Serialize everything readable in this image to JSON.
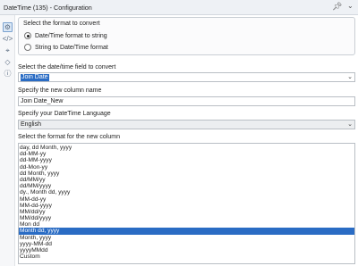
{
  "window": {
    "title": "DateTime (135) - Configuration",
    "pin_icon": "pin-icon",
    "menu_icon": "chevron-down-icon"
  },
  "toolrail": [
    "gear-icon",
    "code-icon",
    "target-icon",
    "tag-icon",
    "help-icon"
  ],
  "format_group": {
    "title": "Select the format to convert",
    "options": [
      {
        "label": "Date/Time format to string",
        "checked": true
      },
      {
        "label": "String to Date/Time format",
        "checked": false
      }
    ]
  },
  "field": {
    "label": "Select the date/time field to convert",
    "value": "Join Date"
  },
  "new_column": {
    "label": "Specify the new column name",
    "value": "Join Date_New"
  },
  "language": {
    "label": "Specify your DateTime Language",
    "value": "English"
  },
  "formats": {
    "label": "Select the format for the new column",
    "items": [
      "day, dd Month, yyyy",
      "dd-MM-yy",
      "dd-MM-yyyy",
      "dd-Mon-yy",
      "dd Month, yyyy",
      "dd/MM/yy",
      "dd/MM/yyyy",
      "dy., Month dd, yyyy",
      "MM-dd-yy",
      "MM-dd-yyyy",
      "MM/dd/yy",
      "MM/dd/yyyy",
      "Mon dd",
      "Month dd, yyyy",
      "Month, yyyy",
      "yyyy-MM-dd",
      "yyyyMMdd",
      "Custom"
    ],
    "selected": "Month dd, yyyy"
  }
}
